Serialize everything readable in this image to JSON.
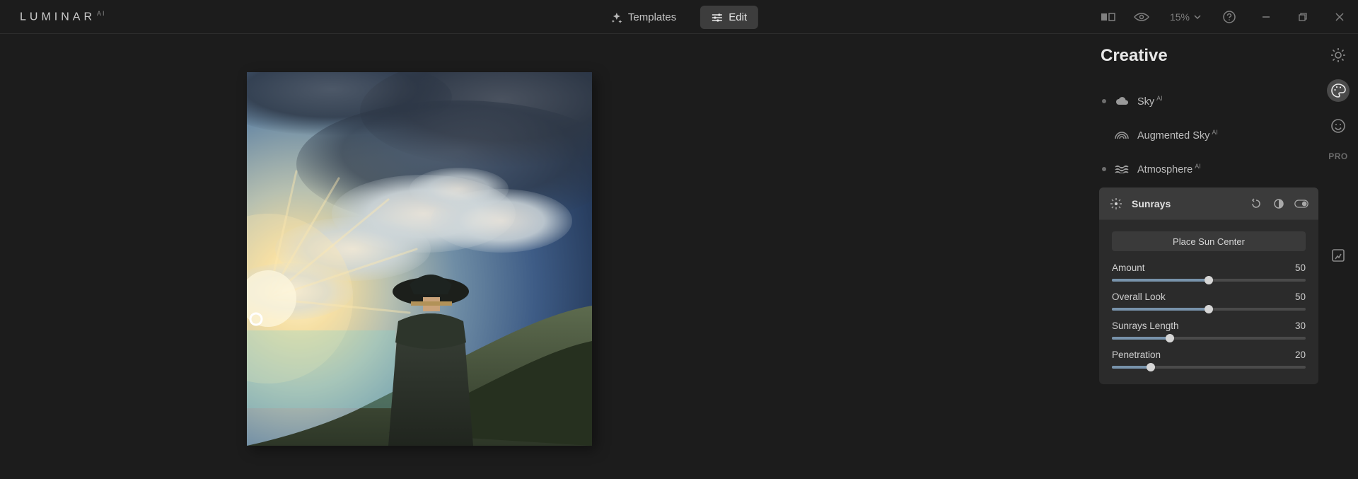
{
  "app": {
    "name": "LUMINAR",
    "suffix": "AI"
  },
  "modes": {
    "templates": "Templates",
    "edit": "Edit"
  },
  "zoom": {
    "label": "15%"
  },
  "panel": {
    "title": "Creative",
    "tools": {
      "sky": "Sky",
      "augsky": "Augmented Sky",
      "atmo": "Atmosphere"
    },
    "ai": "AI"
  },
  "sunrays": {
    "title": "Sunrays",
    "place": "Place Sun Center",
    "sliders": [
      {
        "label": "Amount",
        "value": "50",
        "pct": 50
      },
      {
        "label": "Overall Look",
        "value": "50",
        "pct": 50
      },
      {
        "label": "Sunrays Length",
        "value": "30",
        "pct": 30
      },
      {
        "label": "Penetration",
        "value": "20",
        "pct": 20
      }
    ]
  },
  "rail": {
    "pro": "PRO"
  }
}
